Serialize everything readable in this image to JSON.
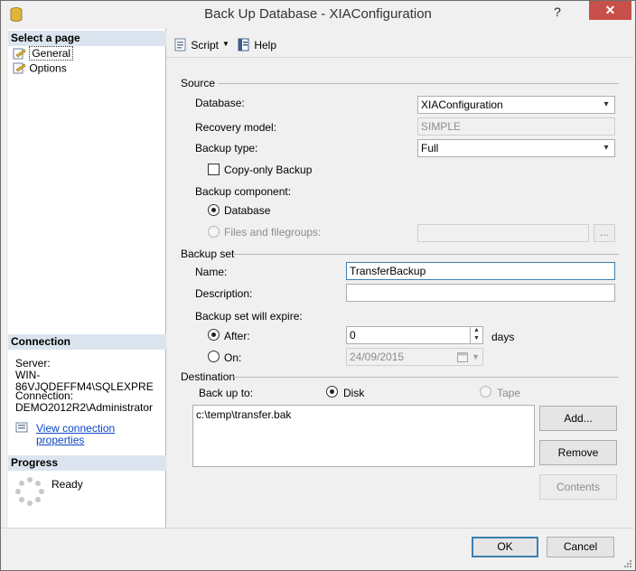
{
  "window": {
    "title": "Back Up Database - XIAConfiguration",
    "help_glyph": "?",
    "close_glyph": "✕"
  },
  "left": {
    "select_page_header": "Select a page",
    "pages": [
      "General",
      "Options"
    ],
    "connection_header": "Connection",
    "server_label": "Server:",
    "server_value": "WIN-86VJQDEFFM4\\SQLEXPRE",
    "connection_label": "Connection:",
    "connection_value": "DEMO2012R2\\Administrator",
    "view_props_link": "View connection properties",
    "progress_header": "Progress",
    "progress_status": "Ready"
  },
  "toolbar": {
    "script_label": "Script",
    "dropdown_glyph": "▼",
    "help_label": "Help"
  },
  "source": {
    "header": "Source",
    "database_label": "Database:",
    "database_value": "XIAConfiguration",
    "recovery_label": "Recovery model:",
    "recovery_value": "SIMPLE",
    "backup_type_label": "Backup type:",
    "backup_type_value": "Full",
    "copy_only_label": "Copy-only Backup",
    "component_label": "Backup component:",
    "component_database": "Database",
    "component_files": "Files and filegroups:",
    "files_browse": "...",
    "combo_arrow": "▾"
  },
  "backup_set": {
    "header": "Backup set",
    "name_label": "Name:",
    "name_value": "TransferBackup",
    "description_label": "Description:",
    "description_value": "",
    "expire_label": "Backup set will expire:",
    "after_label": "After:",
    "after_value": "0",
    "days_label": "days",
    "on_label": "On:",
    "on_value": "24/09/2015",
    "spin_up": "▲",
    "spin_down": "▼"
  },
  "destination": {
    "header": "Destination",
    "back_up_to_label": "Back up to:",
    "disk_label": "Disk",
    "tape_label": "Tape",
    "items": [
      "c:\\temp\\transfer.bak"
    ],
    "add_label": "Add...",
    "remove_label": "Remove",
    "contents_label": "Contents"
  },
  "footer": {
    "ok_label": "OK",
    "cancel_label": "Cancel"
  }
}
